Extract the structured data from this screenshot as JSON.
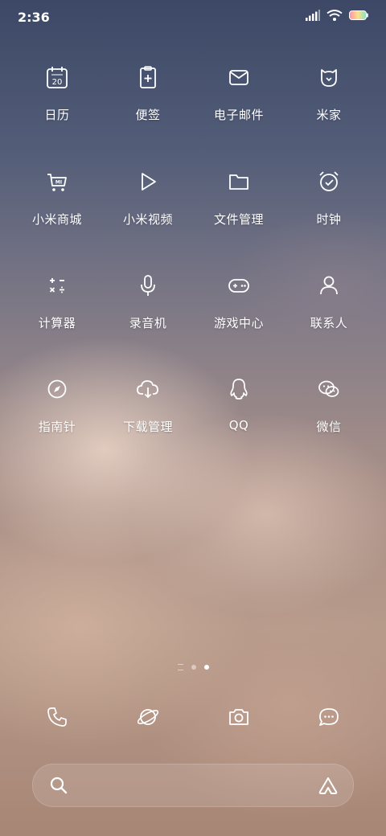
{
  "status": {
    "time": "2:36"
  },
  "apps": [
    {
      "label": "日历",
      "icon": "calendar-icon",
      "badge": "20"
    },
    {
      "label": "便签",
      "icon": "notes-icon"
    },
    {
      "label": "电子邮件",
      "icon": "mail-icon"
    },
    {
      "label": "米家",
      "icon": "mijia-icon"
    },
    {
      "label": "小米商城",
      "icon": "shopping-cart-icon",
      "badge": "MI"
    },
    {
      "label": "小米视频",
      "icon": "play-icon"
    },
    {
      "label": "文件管理",
      "icon": "folder-icon"
    },
    {
      "label": "时钟",
      "icon": "alarm-clock-icon"
    },
    {
      "label": "计算器",
      "icon": "calculator-icon"
    },
    {
      "label": "录音机",
      "icon": "microphone-icon"
    },
    {
      "label": "游戏中心",
      "icon": "gamepad-icon"
    },
    {
      "label": "联系人",
      "icon": "person-icon"
    },
    {
      "label": "指南针",
      "icon": "compass-icon"
    },
    {
      "label": "下载管理",
      "icon": "cloud-download-icon"
    },
    {
      "label": "QQ",
      "icon": "qq-penguin-icon"
    },
    {
      "label": "微信",
      "icon": "wechat-icon"
    }
  ],
  "dock": [
    "phone-icon",
    "browser-planet-icon",
    "camera-icon",
    "messages-icon"
  ],
  "pager": {
    "pages": 3,
    "active": 3
  },
  "search": {
    "icon": "search-icon",
    "assistant_icon": "assistant-icon"
  }
}
